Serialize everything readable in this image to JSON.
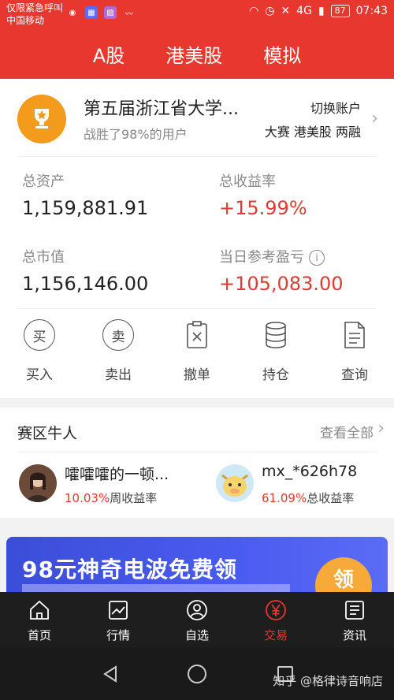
{
  "status_bar": {
    "line1": "仅限紧急呼叫",
    "line2": "中国移动",
    "network": "4G",
    "battery": "87",
    "time": "07:43"
  },
  "top_tabs": [
    "A股",
    "港美股",
    "模拟"
  ],
  "contest": {
    "title": "第五届浙江省大学...",
    "subtitle": "战胜了98%的用户",
    "switch_label": "切换账户",
    "switch_tags": "大赛 港美股 两融"
  },
  "metrics": {
    "total_assets_label": "总资产",
    "total_assets": "1,159,881.91",
    "total_return_label": "总收益率",
    "total_return": "+15.99%",
    "market_value_label": "总市值",
    "market_value": "1,156,146.00",
    "daily_pnl_label": "当日参考盈亏",
    "daily_pnl": "+105,083.00"
  },
  "actions": [
    {
      "label": "买入",
      "icon_char": "买"
    },
    {
      "label": "卖出",
      "icon_char": "卖"
    },
    {
      "label": "撤单"
    },
    {
      "label": "持仓"
    },
    {
      "label": "查询"
    }
  ],
  "niu": {
    "title": "赛区牛人",
    "more": "查看全部",
    "users": [
      {
        "name": "嚯嚯嚯的一顿...",
        "pct": "10.03%",
        "stat_label": "周收益率"
      },
      {
        "name": "mx_*626h78",
        "pct": "61.09%",
        "stat_label": "总收益率"
      }
    ]
  },
  "banner": {
    "text": "98元神奇电波免费领",
    "button": "领"
  },
  "bottom_nav": [
    {
      "label": "首页",
      "active": false
    },
    {
      "label": "行情",
      "active": false
    },
    {
      "label": "自选",
      "active": false
    },
    {
      "label": "交易",
      "active": true
    },
    {
      "label": "资讯",
      "active": false
    }
  ],
  "watermark": "知乎 @格律诗音响店",
  "colors": {
    "brand_red": "#e8372f",
    "gain_red": "#e03a33",
    "trophy_orange": "#f29b1d"
  }
}
